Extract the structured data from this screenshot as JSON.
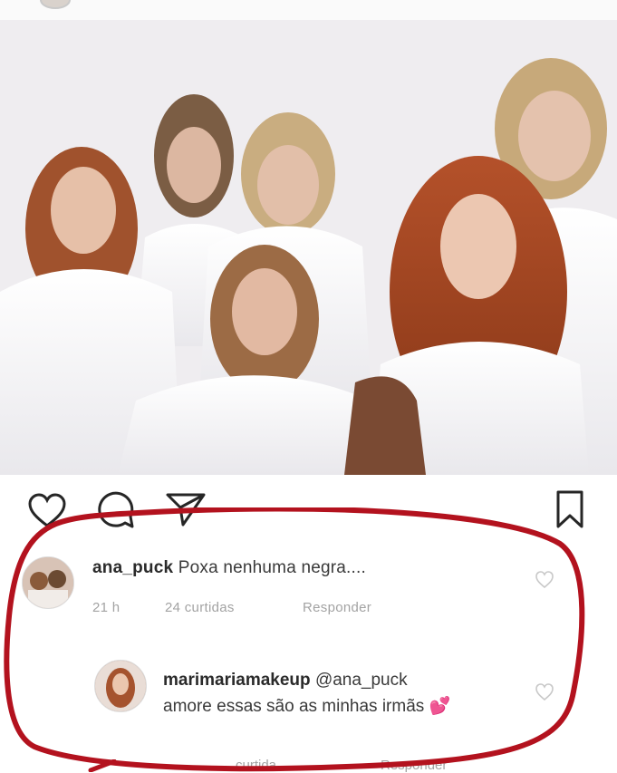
{
  "post": {
    "photo_label": "group photo of six women in white shirts"
  },
  "actions": {
    "heart_icon": "heart-icon",
    "comment_icon": "comment-icon",
    "share_icon": "paper-plane-icon",
    "save_icon": "bookmark-icon"
  },
  "comments": [
    {
      "username": "ana_puck",
      "text": "Poxa nenhuma negra....",
      "time": "21 h",
      "likes": "24 curtidas",
      "reply": "Responder"
    },
    {
      "username": "marimariamakeup",
      "mention": "@ana_puck",
      "text": "amore essas são as minhas irmãs",
      "emoji": "💕",
      "likes": "curtida",
      "reply": "Responder"
    }
  ],
  "colors": {
    "highlight": "#b3121e",
    "meta_text": "#a3a3a3",
    "text": "#262626"
  }
}
